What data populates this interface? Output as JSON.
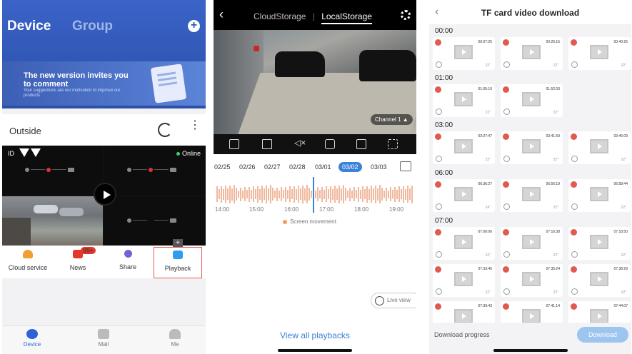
{
  "panel1": {
    "tabs": [
      "Device",
      "Group"
    ],
    "banner": {
      "headline": "The new version invites you to comment",
      "sub": "Your suggestions are our motivation to improve our products"
    },
    "group_name": "Outside",
    "camera_id": "ID",
    "status": "Online",
    "actions": [
      {
        "label": "Cloud service",
        "color": "#f0a030"
      },
      {
        "label": "News",
        "color": "#e5382d",
        "badge": "99+"
      },
      {
        "label": "Share",
        "color": "#7b5fd1"
      },
      {
        "label": "Playback",
        "color": "#2f9cf0"
      }
    ],
    "nav": [
      "Device",
      "Mall",
      "Me"
    ]
  },
  "panel2": {
    "tabs": [
      "CloudStorage",
      "LocalStorage"
    ],
    "channel": "Channel 1 ▲",
    "dates": [
      "02/25",
      "02/26",
      "02/27",
      "02/28",
      "03/01",
      "03/02",
      "03/03"
    ],
    "selected_date": "03/02",
    "hours": [
      "14:00",
      "15:00",
      "16:00",
      "17:00",
      "18:00",
      "19:00"
    ],
    "legend": "Screen movement",
    "live_view": "Live view",
    "view_all": "View all playbacks"
  },
  "panel3": {
    "title": "TF card video download",
    "groups": [
      {
        "hour": "00:00",
        "clips": [
          {
            "time": "00:07:25",
            "dur": "22\""
          },
          {
            "time": "00:26:15",
            "dur": "22\""
          },
          {
            "time": "00:40:25",
            "dur": "22\""
          }
        ]
      },
      {
        "hour": "01:00",
        "clips": [
          {
            "time": "01:05:10",
            "dur": "22\""
          },
          {
            "time": "01:52:03",
            "dur": "22\""
          }
        ]
      },
      {
        "hour": "03:00",
        "clips": [
          {
            "time": "03:27:47",
            "dur": "22\""
          },
          {
            "time": "03:41:59",
            "dur": "22\""
          },
          {
            "time": "03:46:09",
            "dur": "22\""
          }
        ]
      },
      {
        "hour": "06:00",
        "clips": [
          {
            "time": "06:36:27",
            "dur": "24\""
          },
          {
            "time": "06:56:19",
            "dur": "22\""
          },
          {
            "time": "06:58:44",
            "dur": "22\""
          }
        ]
      },
      {
        "hour": "07:00",
        "clips": [
          {
            "time": "07:06:06",
            "dur": "22\""
          },
          {
            "time": "07:16:38",
            "dur": "22\""
          },
          {
            "time": "07:18:50",
            "dur": "22\""
          },
          {
            "time": "07:33:46",
            "dur": "22\""
          },
          {
            "time": "07:35:24",
            "dur": "22\""
          },
          {
            "time": "07:38:29",
            "dur": "22\""
          },
          {
            "time": "07:39:43",
            "dur": "22\""
          },
          {
            "time": "07:41:14",
            "dur": "22\""
          },
          {
            "time": "07:44:07",
            "dur": "22\""
          }
        ]
      }
    ],
    "progress_label": "Download progress",
    "download_label": "Download"
  }
}
